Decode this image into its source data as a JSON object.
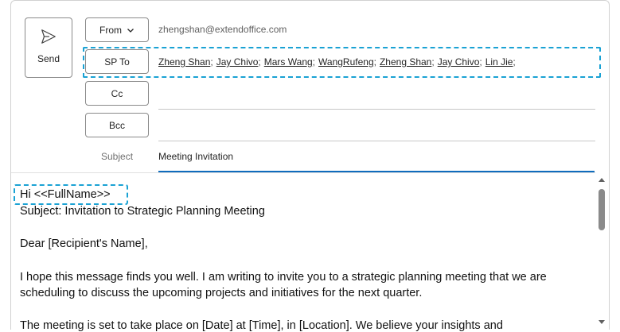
{
  "compose": {
    "send_label": "Send",
    "from_label": "From",
    "from_address": "zhengshan@extendoffice.com",
    "to_label": "SP To",
    "cc_label": "Cc",
    "bcc_label": "Bcc",
    "recipients": [
      "Zheng Shan",
      "Jay Chivo",
      "Mars Wang",
      "WangRufeng",
      "Zheng Shan",
      "Jay Chivo",
      "Lin Jie"
    ],
    "recipient_separator": ";",
    "subject_label": "Subject",
    "subject_value": "Meeting Invitation"
  },
  "body": {
    "greeting": "Hi <<FullName>>",
    "subject_line": "Subject: Invitation to Strategic Planning Meeting",
    "salutation": "Dear [Recipient's Name],",
    "paragraph1_line1": "I hope this message finds you well. I am writing to invite you to a strategic planning meeting that we are",
    "paragraph1_line2": "scheduling to discuss the upcoming projects and initiatives for the next quarter.",
    "paragraph2_line1": "The meeting is set to take place on [Date] at [Time], in [Location]. We believe your insights and"
  },
  "colors": {
    "accent": "#0f6cbd",
    "highlight_dash": "#1aa2d4"
  },
  "icons": {
    "send": "send-icon",
    "from_dropdown": "chevron-down-icon",
    "scroll_up": "arrow-up-icon",
    "scroll_down": "arrow-down-icon"
  }
}
